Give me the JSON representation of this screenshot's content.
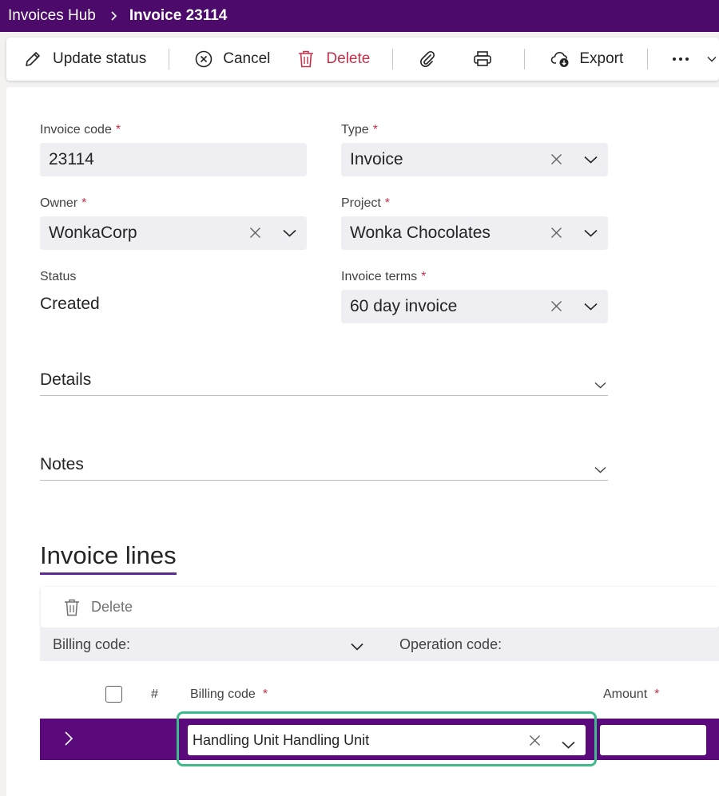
{
  "header": {
    "breadcrumb_root": "Invoices Hub",
    "breadcrumb_current": "Invoice 23114"
  },
  "toolbar": {
    "update_status_label": "Update status",
    "cancel_label": "Cancel",
    "delete_label": "Delete",
    "export_label": "Export"
  },
  "form": {
    "invoice_code": {
      "label": "Invoice code",
      "required_mark": "*",
      "value": "23114"
    },
    "type": {
      "label": "Type",
      "required_mark": "*",
      "value": "Invoice"
    },
    "owner": {
      "label": "Owner",
      "required_mark": "*",
      "value": "WonkaCorp"
    },
    "project": {
      "label": "Project",
      "required_mark": "*",
      "value": "Wonka Chocolates"
    },
    "status": {
      "label": "Status",
      "value": "Created"
    },
    "invoice_terms": {
      "label": "Invoice terms",
      "required_mark": "*",
      "value": "60 day invoice"
    }
  },
  "sections": {
    "details": "Details",
    "notes": "Notes"
  },
  "invoice_lines": {
    "title": "Invoice lines",
    "delete_label": "Delete",
    "filter_billing_code": "Billing code:",
    "filter_operation_code": "Operation code:",
    "columns": {
      "number": "#",
      "billing_code": "Billing code",
      "amount": "Amount",
      "required_mark": "*"
    },
    "rows": [
      {
        "billing_code": "Handling Unit Handling Unit",
        "amount": ""
      }
    ]
  },
  "colors": {
    "header_bg": "#4c0a6b",
    "row_selected_bg": "#5a0a7a",
    "focus_outline": "#3fba8c",
    "delete_red": "#c4314b",
    "required_red": "#c4314b"
  }
}
